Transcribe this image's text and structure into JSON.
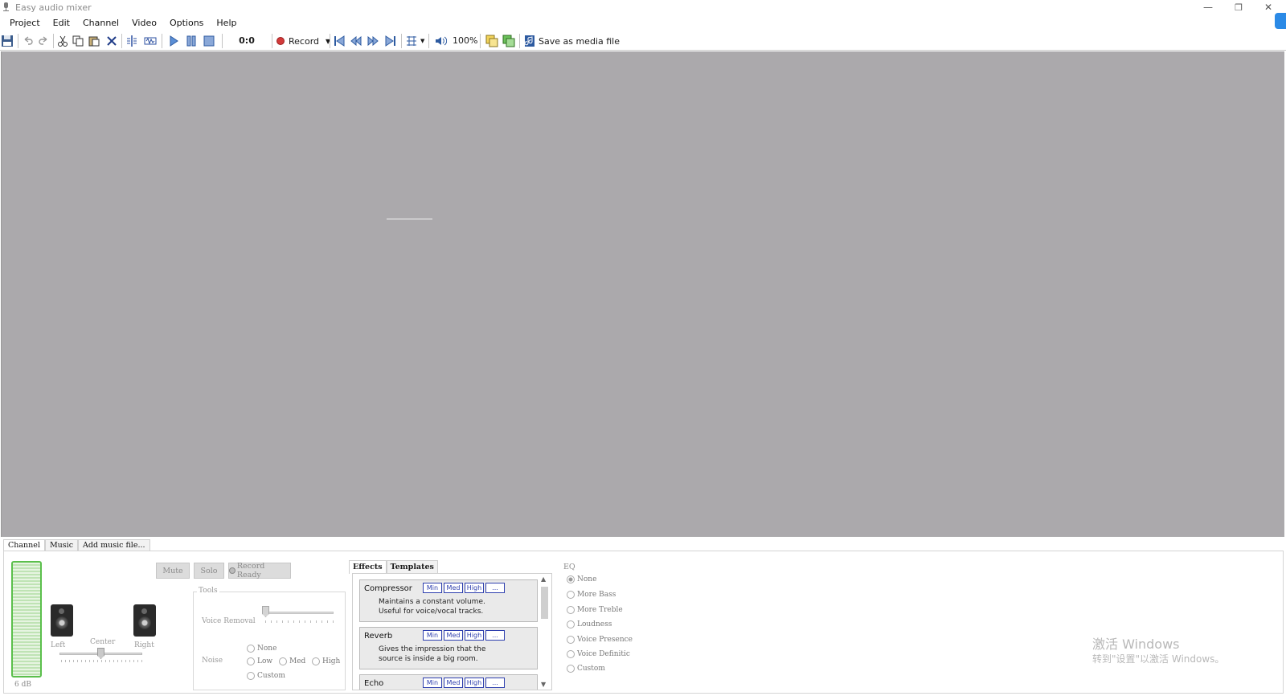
{
  "window": {
    "title": "Easy audio mixer"
  },
  "menu": [
    "Project",
    "Edit",
    "Channel",
    "Video",
    "Options",
    "Help"
  ],
  "toolbar": {
    "time": "0:0",
    "record_label": "Record",
    "zoom": "100%",
    "save_media_label": "Save as media file"
  },
  "bottom_tabs": [
    "Channel",
    "Music",
    "Add music file..."
  ],
  "channel": {
    "db_label": "6 dB",
    "left_label": "Left",
    "center_label": "Center",
    "right_label": "Right",
    "mute_label": "Mute",
    "solo_label": "Solo",
    "record_ready_label": "Record Ready"
  },
  "tools": {
    "legend": "Tools",
    "voice_removal_label": "Voice Removal",
    "noise_label": "Noise",
    "noise_options": [
      "None",
      "Low",
      "Med",
      "High",
      "Custom"
    ]
  },
  "effects": {
    "tabs": [
      "Effects",
      "Templates"
    ],
    "level_buttons": [
      "Min",
      "Med",
      "High",
      "..."
    ],
    "items": [
      {
        "name": "Compressor",
        "desc1": "Maintains a constant volume.",
        "desc2": "Useful for voice/vocal tracks."
      },
      {
        "name": "Reverb",
        "desc1": "Gives the impression that the",
        "desc2": "source is inside a big room."
      },
      {
        "name": "Echo",
        "desc1": "",
        "desc2": ""
      }
    ]
  },
  "eq": {
    "title": "EQ",
    "options": [
      "None",
      "More Bass",
      "More Treble",
      "Loudness",
      "Voice Presence",
      "Voice Definitic",
      "Custom"
    ]
  },
  "watermark": {
    "line1": "激活 Windows",
    "line2": "转到\"设置\"以激活 Windows。"
  }
}
